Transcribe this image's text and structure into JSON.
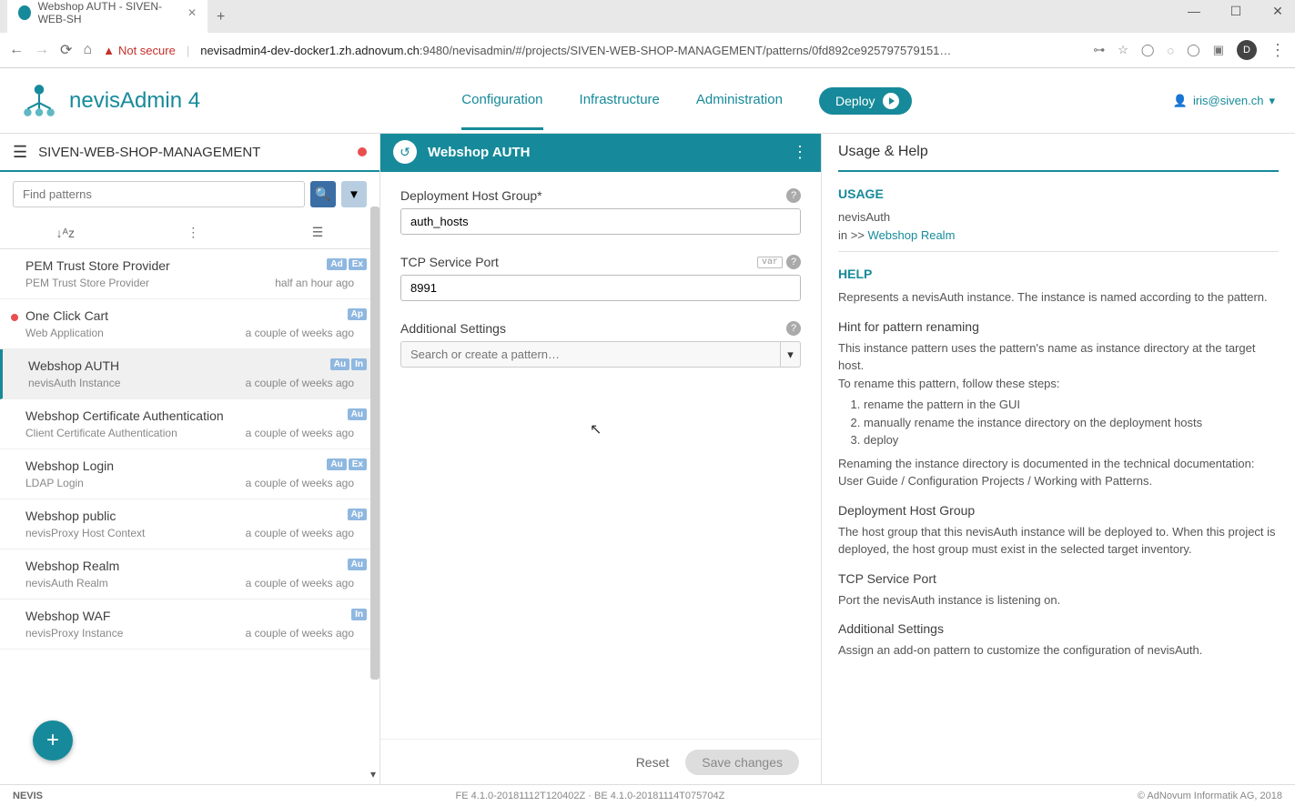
{
  "browser": {
    "tab_title": "Webshop AUTH - SIVEN-WEB-SH",
    "not_secure": "Not secure",
    "url_host": "nevisadmin4-dev-docker1.zh.adnovum.ch",
    "url_rest": ":9480/nevisadmin/#/projects/SIVEN-WEB-SHOP-MANAGEMENT/patterns/0fd892ce925797579151…",
    "avatar_letter": "D"
  },
  "header": {
    "app_title": "nevisAdmin 4",
    "nav": {
      "configuration": "Configuration",
      "infrastructure": "Infrastructure",
      "administration": "Administration"
    },
    "deploy": "Deploy",
    "user": "iris@siven.ch"
  },
  "sidebar": {
    "project": "SIVEN-WEB-SHOP-MANAGEMENT",
    "search_placeholder": "Find patterns",
    "items": [
      {
        "title": "PEM Trust Store Provider",
        "subtitle": "PEM Trust Store Provider",
        "time": "half an hour ago",
        "badges": [
          "Ad",
          "Ex"
        ],
        "dot": false,
        "selected": false
      },
      {
        "title": "One Click Cart",
        "subtitle": "Web Application",
        "time": "a couple of weeks ago",
        "badges": [
          "Ap"
        ],
        "dot": true,
        "selected": false
      },
      {
        "title": "Webshop AUTH",
        "subtitle": "nevisAuth Instance",
        "time": "a couple of weeks ago",
        "badges": [
          "Au",
          "In"
        ],
        "dot": false,
        "selected": true
      },
      {
        "title": "Webshop Certificate Authentication",
        "subtitle": "Client Certificate Authentication",
        "time": "a couple of weeks ago",
        "badges": [
          "Au"
        ],
        "dot": false,
        "selected": false
      },
      {
        "title": "Webshop Login",
        "subtitle": "LDAP Login",
        "time": "a couple of weeks ago",
        "badges": [
          "Au",
          "Ex"
        ],
        "dot": false,
        "selected": false
      },
      {
        "title": "Webshop public",
        "subtitle": "nevisProxy Host Context",
        "time": "a couple of weeks ago",
        "badges": [
          "Ap"
        ],
        "dot": false,
        "selected": false
      },
      {
        "title": "Webshop Realm",
        "subtitle": "nevisAuth Realm",
        "time": "a couple of weeks ago",
        "badges": [
          "Au"
        ],
        "dot": false,
        "selected": false
      },
      {
        "title": "Webshop WAF",
        "subtitle": "nevisProxy Instance",
        "time": "a couple of weeks ago",
        "badges": [
          "In"
        ],
        "dot": false,
        "selected": false
      }
    ]
  },
  "form": {
    "header_title": "Webshop AUTH",
    "fields": {
      "host_group_label": "Deployment Host Group*",
      "host_group_value": "auth_hosts",
      "tcp_port_label": "TCP Service Port",
      "tcp_port_value": "8991",
      "var_badge": "var",
      "additional_label": "Additional Settings",
      "additional_placeholder": "Search or create a pattern…"
    },
    "reset": "Reset",
    "save": "Save changes"
  },
  "help": {
    "title": "Usage & Help",
    "usage_head": "USAGE",
    "usage_instance": "nevisAuth",
    "usage_in": "in >> ",
    "usage_link": "Webshop Realm",
    "help_head": "HELP",
    "help_intro": "Represents a nevisAuth instance. The instance is named according to the pattern.",
    "hint_head": "Hint for pattern renaming",
    "hint_p1": "This instance pattern uses the pattern's name as instance directory at the target host.",
    "hint_p2": "To rename this pattern, follow these steps:",
    "step1": "rename the pattern in the GUI",
    "step2": "manually rename the instance directory on the deployment hosts",
    "step3": "deploy",
    "hint_p3": "Renaming the instance directory is documented in the technical documentation: User Guide / Configuration Projects / Working with Patterns.",
    "dhg_head": "Deployment Host Group",
    "dhg_text": "The host group that this nevisAuth instance will be deployed to. When this project is deployed, the host group must exist in the selected target inventory.",
    "tcp_head": "TCP Service Port",
    "tcp_text": "Port the nevisAuth instance is listening on.",
    "add_head": "Additional Settings",
    "add_text": "Assign an add-on pattern to customize the configuration of nevisAuth."
  },
  "footer": {
    "logo": "NEVIS",
    "version": "FE 4.1.0-20181112T120402Z · BE 4.1.0-20181114T075704Z",
    "copyright": "© AdNovum Informatik AG, 2018"
  }
}
